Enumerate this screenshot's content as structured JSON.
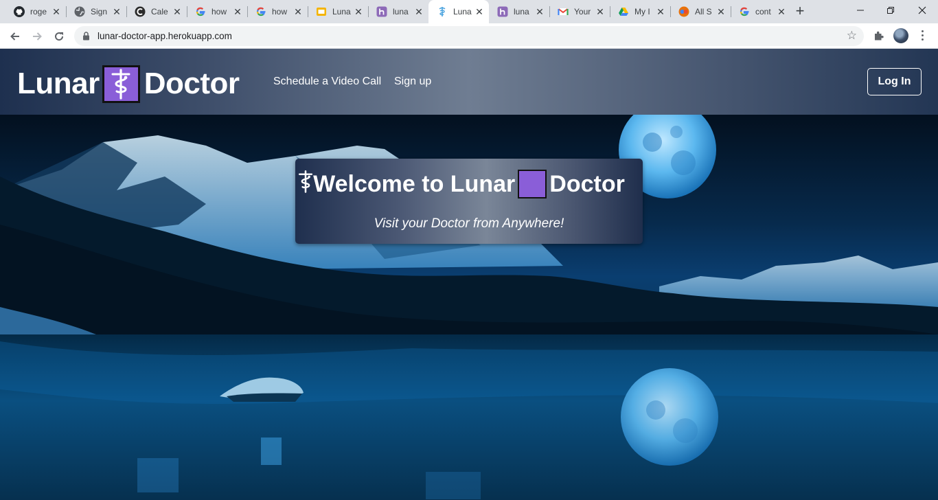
{
  "browser": {
    "tabs": [
      {
        "title": "roge",
        "icon": "github-icon"
      },
      {
        "title": "Sign",
        "icon": "globe-icon"
      },
      {
        "title": "Cale",
        "icon": "calendly-icon"
      },
      {
        "title": "how",
        "icon": "google-icon"
      },
      {
        "title": "how",
        "icon": "google-icon"
      },
      {
        "title": "Luna",
        "icon": "slides-icon"
      },
      {
        "title": "luna",
        "icon": "heroku-icon"
      },
      {
        "title": "Luna",
        "icon": "caduceus-icon",
        "active": true
      },
      {
        "title": "luna",
        "icon": "heroku-icon"
      },
      {
        "title": "Your",
        "icon": "gmail-icon"
      },
      {
        "title": "My I",
        "icon": "drive-icon"
      },
      {
        "title": "All S",
        "icon": "all-icon"
      },
      {
        "title": "cont",
        "icon": "google-icon"
      }
    ],
    "close_glyph": "✕",
    "new_tab_glyph": "+",
    "url": "lunar-doctor-app.herokuapp.com"
  },
  "site": {
    "brand_left": "Lunar",
    "brand_right": "Doctor",
    "nav": {
      "schedule": "Schedule a Video Call",
      "signup": "Sign up"
    },
    "login": "Log In"
  },
  "hero": {
    "welcome_prefix": "Welcome to Lunar",
    "welcome_suffix": "Doctor",
    "tagline": "Visit your Doctor from Anywhere!"
  },
  "colors": {
    "brand_purple": "#8a5ed8",
    "header_dark": "#1e304f",
    "header_light": "#6f7d92"
  }
}
